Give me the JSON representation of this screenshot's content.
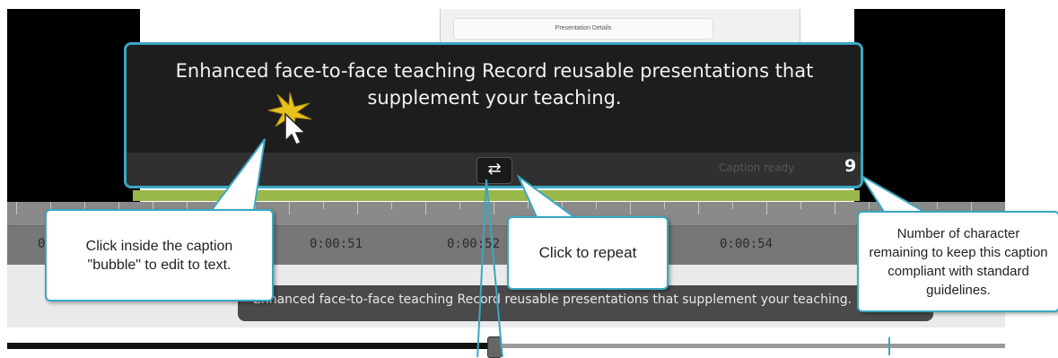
{
  "document_preview": {
    "header": "Presentation Details"
  },
  "caption_bubble": {
    "text": "Enhanced face-to-face teaching Record reusable presentations that supplement your teaching.",
    "repeat_icon": "repeat-icon",
    "status_label": "Caption ready",
    "characters_remaining": "9"
  },
  "timeline": {
    "time_labels": [
      "0",
      "0:00:51",
      "0:00:52",
      "0:00:54"
    ]
  },
  "caption_track": {
    "text": "Enhanced face-to-face teaching Record reusable presentations that supplement your teaching."
  },
  "callouts": {
    "edit": "Click inside the caption \"bubble\" to edit to text.",
    "repeat": "Click to repeat",
    "count": "Number of character remaining to keep this caption compliant with standard guidelines."
  },
  "colors": {
    "accent": "#3aa7c2",
    "timeline_strip": "#9ab84a"
  }
}
